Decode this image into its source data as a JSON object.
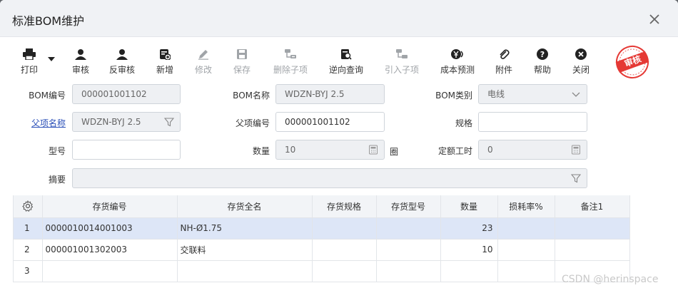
{
  "window": {
    "title": "标准BOM维护"
  },
  "toolbar": {
    "print": "打印",
    "audit": "审核",
    "unaudit": "反审核",
    "add": "新增",
    "edit": "修改",
    "save": "保存",
    "delete_child": "删除子项",
    "reverse_query": "逆向查询",
    "import_child": "引入子项",
    "cost_forecast": "成本预测",
    "attachment": "附件",
    "help": "帮助",
    "close": "关闭"
  },
  "stamp": {
    "text": "审核",
    "color": "#e53935"
  },
  "form": {
    "bom_no": {
      "label": "BOM编号",
      "value": "000001001102"
    },
    "bom_name": {
      "label": "BOM名称",
      "value": "WDZN-BYJ 2.5"
    },
    "bom_type": {
      "label": "BOM类别",
      "value": "电线"
    },
    "parent_name": {
      "label": "父项名称",
      "value": "WDZN-BYJ 2.5"
    },
    "parent_code": {
      "label": "父项编号",
      "value": "000001001102"
    },
    "spec": {
      "label": "规格",
      "value": ""
    },
    "model": {
      "label": "型号",
      "value": ""
    },
    "quantity": {
      "label": "数量",
      "value": "10",
      "unit": "圈"
    },
    "fixed_hours": {
      "label": "定额工时",
      "value": "0"
    },
    "summary": {
      "label": "摘要",
      "value": ""
    }
  },
  "table": {
    "columns": [
      "存货编号",
      "存货全名",
      "存货规格",
      "存货型号",
      "数量",
      "损耗率%",
      "备注1"
    ],
    "rows": [
      {
        "idx": "1",
        "code": "0000010014001003",
        "name": "NH-Ø1.75",
        "spec": "",
        "model": "",
        "qty": "23",
        "loss": "",
        "note": ""
      },
      {
        "idx": "2",
        "code": "000001001302003",
        "name": "交联料",
        "spec": "",
        "model": "",
        "qty": "10",
        "loss": "",
        "note": ""
      },
      {
        "idx": "3",
        "code": "",
        "name": "",
        "spec": "",
        "model": "",
        "qty": "",
        "loss": "",
        "note": ""
      }
    ]
  },
  "watermark": "CSDN @herinspace",
  "colors": {
    "selected_row": "#dde6f7",
    "link": "#2a4fb8"
  }
}
